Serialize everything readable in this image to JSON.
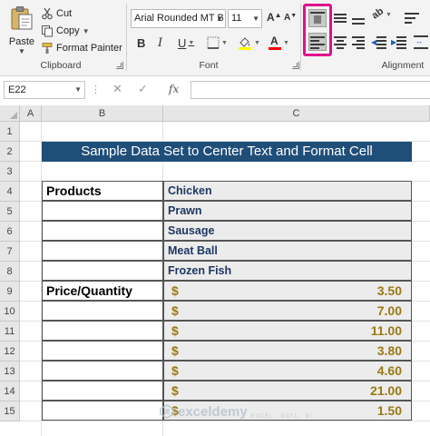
{
  "ribbon": {
    "clipboard": {
      "paste_label": "Paste",
      "cut_label": "Cut",
      "copy_label": "Copy",
      "format_painter_label": "Format Painter",
      "group_label": "Clipboard"
    },
    "font": {
      "font_name": "Arial Rounded MT B",
      "font_size": "11",
      "group_label": "Font",
      "bold": "B",
      "italic": "I",
      "underline": "U"
    },
    "alignment": {
      "group_label": "Alignment"
    }
  },
  "formula_bar": {
    "name_box": "E22",
    "fx": "fx",
    "formula": ""
  },
  "grid": {
    "columns": [
      "A",
      "B",
      "C"
    ],
    "rows": [
      "1",
      "2",
      "3",
      "4",
      "5",
      "6",
      "7",
      "8",
      "9",
      "10",
      "11",
      "12",
      "13",
      "14",
      "15"
    ],
    "title": "Sample Data Set to Center Text and Format Cell",
    "products_header": "Products",
    "products": [
      "Chicken",
      "Prawn",
      "Sausage",
      "Meat Ball",
      "Frozen Fish"
    ],
    "price_header": "Price/Quantity",
    "currency_symbol": "$",
    "prices": [
      "3.50",
      "7.00",
      "11.00",
      "3.80",
      "4.60",
      "21.00",
      "1.50"
    ]
  },
  "watermark": {
    "name": "exceldemy",
    "tagline": "EXCEL · DATA · BI"
  },
  "colors": {
    "title_fill": "#1f4e78",
    "price_text": "#9a7814",
    "product_text": "#1f3864",
    "highlight": "#e0108c"
  }
}
